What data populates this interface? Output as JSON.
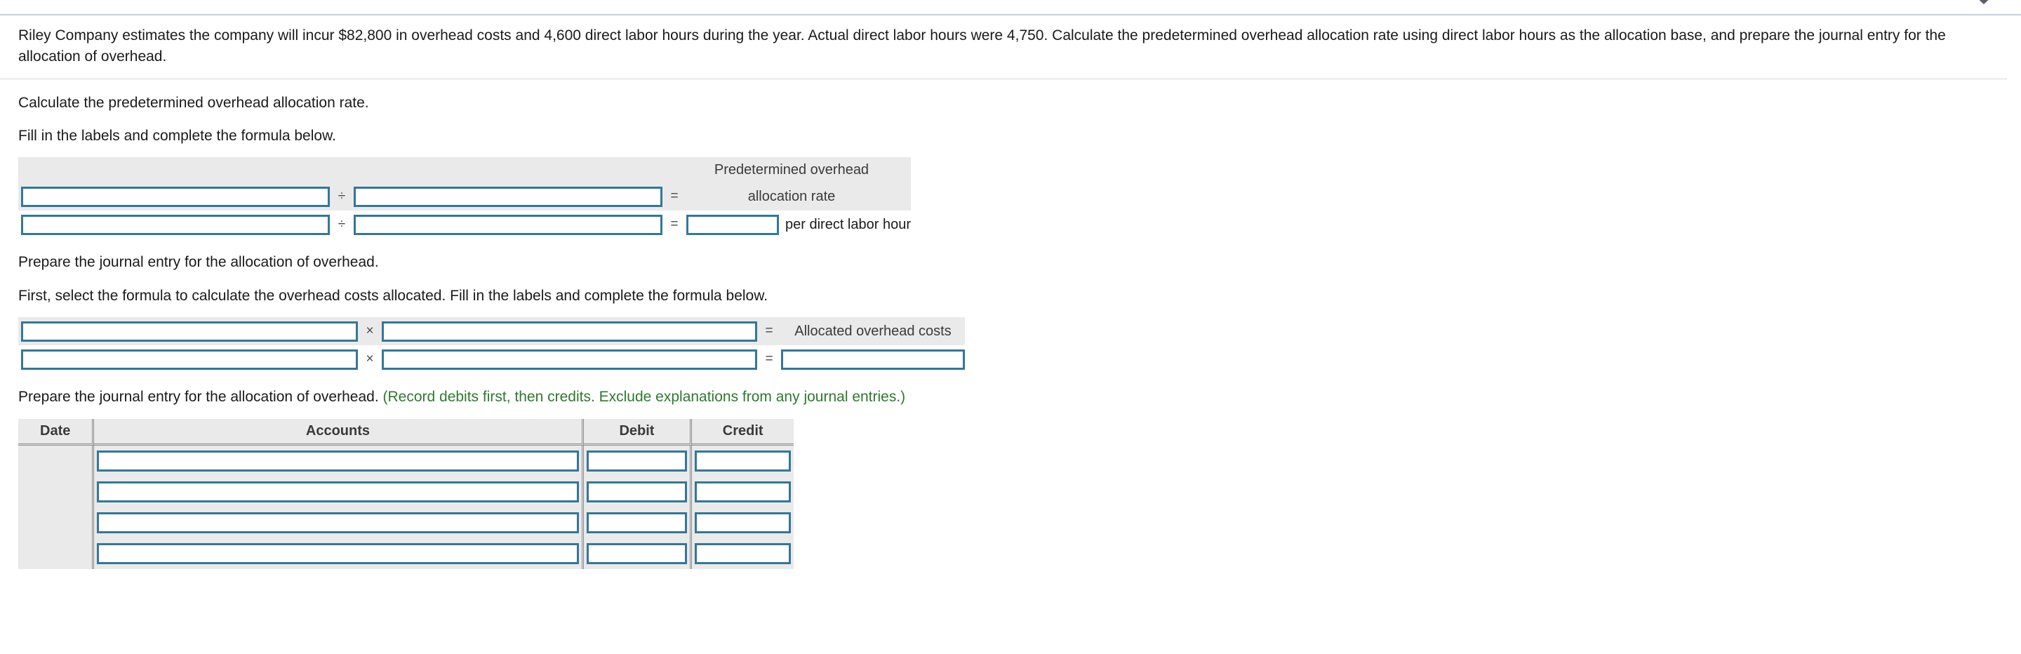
{
  "topbar": {
    "icon": "collapse-caret-icon"
  },
  "question": {
    "stem": "Riley Company estimates the company will incur $82,800 in overhead costs and 4,600 direct labor hours during the year. Actual direct labor hours were 4,750. Calculate the predetermined overhead allocation rate using direct labor hours as the allocation base, and prepare the journal entry for the allocation of overhead."
  },
  "part1": {
    "prompt": "Calculate the predetermined overhead allocation rate.",
    "instruction": "Fill in the labels and complete the formula below.",
    "result_label_line1": "Predetermined overhead",
    "result_label_line2": "allocation rate",
    "operator": "÷",
    "equals": "=",
    "unit_suffix": "per direct labor hour"
  },
  "part2": {
    "prompt": "Prepare the journal entry for the allocation of overhead.",
    "instruction": "First, select the formula to calculate the overhead costs allocated. Fill in the labels and complete the formula below.",
    "operator": "×",
    "equals": "=",
    "result_label": "Allocated overhead costs"
  },
  "part3": {
    "prompt": "Prepare the journal entry for the allocation of overhead.",
    "note": "(Record debits first, then credits. Exclude explanations from any journal entries.)",
    "table": {
      "headers": [
        "Date",
        "Accounts",
        "Debit",
        "Credit"
      ],
      "rows": [
        {
          "date": "",
          "accounts": "",
          "debit": "",
          "credit": ""
        },
        {
          "date": "",
          "accounts": "",
          "debit": "",
          "credit": ""
        },
        {
          "date": "",
          "accounts": "",
          "debit": "",
          "credit": ""
        },
        {
          "date": "",
          "accounts": "",
          "debit": "",
          "credit": ""
        }
      ]
    }
  },
  "colors": {
    "accent_border": "#337799",
    "panel": "#eaeaea",
    "note_green": "#2c7a2c"
  }
}
